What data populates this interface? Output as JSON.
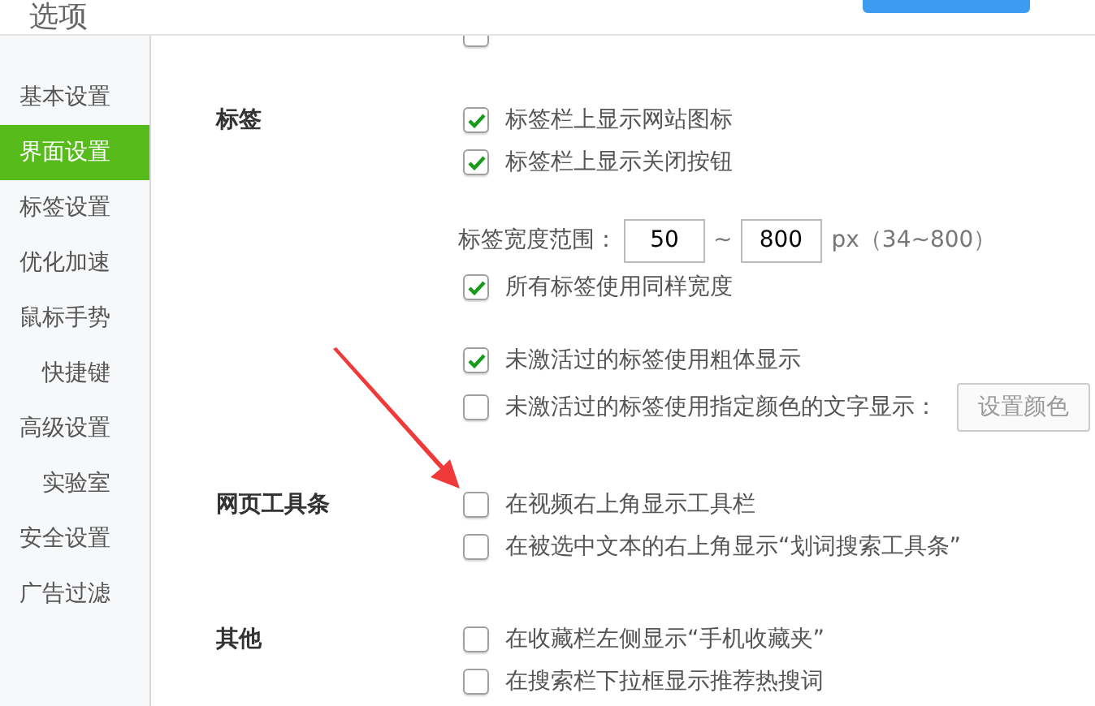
{
  "window": {
    "title": "选项"
  },
  "sidebar": {
    "items": [
      {
        "label": "基本设置",
        "selected": false
      },
      {
        "label": "界面设置",
        "selected": true
      },
      {
        "label": "标签设置",
        "selected": false
      },
      {
        "label": "优化加速",
        "selected": false
      },
      {
        "label": "鼠标手势",
        "selected": false
      },
      {
        "label": "快捷键",
        "selected": false
      },
      {
        "label": "高级设置",
        "selected": false
      },
      {
        "label": "实验室",
        "selected": false
      },
      {
        "label": "安全设置",
        "selected": false
      },
      {
        "label": "广告过滤",
        "selected": false
      }
    ]
  },
  "top_cut_row": {
    "checked": false
  },
  "sections": [
    {
      "title": "标签",
      "groups": [
        [
          {
            "kind": "checkbox",
            "label": "标签栏上显示网站图标",
            "checked": true
          },
          {
            "kind": "checkbox",
            "label": "标签栏上显示关闭按钮",
            "checked": true
          }
        ],
        [
          {
            "kind": "range",
            "label": "标签宽度范围：",
            "min_value": "50",
            "separator": "~",
            "max_value": "800",
            "unit": "px（34~800）"
          },
          {
            "kind": "checkbox",
            "label": "所有标签使用同样宽度",
            "checked": true
          }
        ],
        [
          {
            "kind": "checkbox",
            "label": "未激活过的标签使用粗体显示",
            "checked": true
          },
          {
            "kind": "color",
            "label": "未激活过的标签使用指定颜色的文字显示：",
            "checked": false,
            "button": "设置颜色"
          }
        ]
      ]
    },
    {
      "title": "网页工具条",
      "groups": [
        [
          {
            "kind": "checkbox",
            "label": "在视频右上角显示工具栏",
            "checked": false
          },
          {
            "kind": "checkbox",
            "label": "在被选中文本的右上角显示“划词搜索工具条”",
            "checked": false
          }
        ]
      ]
    },
    {
      "title": "其他",
      "groups": [
        [
          {
            "kind": "checkbox",
            "label": "在收藏栏左侧显示“手机收藏夹”",
            "checked": false
          },
          {
            "kind": "checkbox",
            "label": "在搜索栏下拉框显示推荐热搜词",
            "checked": false
          }
        ]
      ]
    }
  ]
}
